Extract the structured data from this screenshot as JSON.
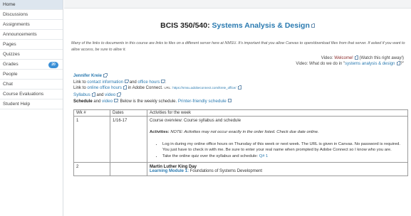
{
  "sidebar": {
    "items": [
      {
        "label": "Home",
        "active": true
      },
      {
        "label": "Discussions"
      },
      {
        "label": "Assignments"
      },
      {
        "label": "Announcements"
      },
      {
        "label": "Pages"
      },
      {
        "label": "Quizzes"
      },
      {
        "label": "Grades",
        "badge": "20"
      },
      {
        "label": "People"
      },
      {
        "label": "Chat"
      },
      {
        "label": "Course Evaluations"
      },
      {
        "label": "Student Help"
      }
    ]
  },
  "page": {
    "title_code": "BCIS 350/540:",
    "title_course": "Systems Analysis & Design",
    "intro": "Many of the links to documents in this course are links to files on a different server here at NMSU.  It's important that you allow Canvas to open/download files from that server.  If asked if you want to allow access, be sure to allow it."
  },
  "videos": {
    "line1_prefix": "Video:",
    "line1_link": "Welcome!",
    "line1_suffix": "(Watch this right away!)",
    "line2_prefix": "Video: What do we do in \"",
    "line2_link": "systems analysis & design",
    "line2_suffix": "?\""
  },
  "instructor": {
    "name": "Jennifer Kreie",
    "line1_prefix": "Link to",
    "contact_link": "contact information",
    "line1_and": "and",
    "office_hours_link": "office hours",
    "line1_end": ".",
    "line2_prefix": "Link to",
    "online_office_link": "online office hours",
    "line2_mid": "in Adobe Connect.",
    "url_label": "URL:",
    "url": "https://nmsu.adobeconnect.com/kreie_office/"
  },
  "syllabus": {
    "syllabus_link": "Syllabus",
    "and": "and",
    "video_link": "video",
    "schedule_bold": "Schedule",
    "schedule_and": "and",
    "schedule_video_link": "video",
    "below_text": ".  Below is the weekly schedule.",
    "printer_link": "Printer-friendly schedule"
  },
  "schedule": {
    "headers": [
      "Wk #",
      "Dates",
      "Activities for the week"
    ],
    "rows": [
      {
        "wk": "1",
        "dates": "1/16-17",
        "title": "Course overview: Course syllabus and schedule",
        "note_label": "Activities:",
        "note_text": "NOTE:  Activities may not occur exactly in the order listed.  Check due date online.",
        "bullets": [
          "Log in during my online office hours on Thursday of this week or next week. The URL is given in Canvas.  No password is required.  You just have to check in with me. Be sure to enter your real name when prompted by Adobe Connect so I know who you are.",
          "Take the online quiz over the syllabus and schedule:"
        ],
        "quiz_link": "Q# 1"
      },
      {
        "wk": "2",
        "dates": "",
        "title": "Martin Luther King Day",
        "module_link": "Learning Module 1:",
        "module_text": "Foundations of Systems Development"
      }
    ]
  }
}
